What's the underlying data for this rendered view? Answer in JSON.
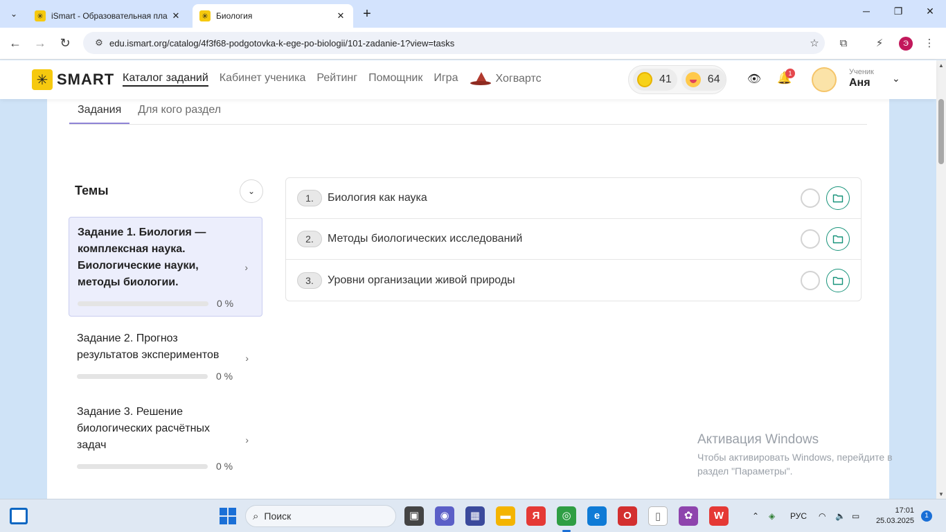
{
  "browser": {
    "tabs": [
      {
        "title": "iSmart - Образовательная пла",
        "active": false
      },
      {
        "title": "Биология",
        "active": true
      }
    ],
    "url": "edu.ismart.org/catalog/4f3f68-podgotovka-k-ege-po-biologii/101-zadanie-1?view=tasks",
    "profile_initial": "Э"
  },
  "header": {
    "logo_text": "SMART",
    "nav": [
      "Каталог заданий",
      "Кабинет ученика",
      "Рейтинг",
      "Помощник",
      "Игра",
      "Хогвартс"
    ],
    "coins": "41",
    "smiles": "64",
    "notifications": "1",
    "user_role": "Ученик",
    "user_name": "Аня"
  },
  "subtabs": [
    "Задания",
    "Для кого раздел"
  ],
  "themes": {
    "title": "Темы",
    "items": [
      {
        "title": "Задание 1. Биология — комплексная наука. Биологические науки, методы биологии.",
        "progress": "0 %",
        "progress_value": 0,
        "selected": true
      },
      {
        "title": "Задание 2. Прогноз результатов экспериментов",
        "progress": "0 %",
        "progress_value": 0,
        "selected": false
      },
      {
        "title": "Задание 3. Решение биологических расчётных задач",
        "progress": "0 %",
        "progress_value": 0,
        "selected": false
      }
    ]
  },
  "tasks": [
    {
      "num": "1.",
      "title": "Биология как наука"
    },
    {
      "num": "2.",
      "title": "Методы биологических исследований"
    },
    {
      "num": "3.",
      "title": "Уровни организации живой природы"
    }
  ],
  "watermark": {
    "title": "Активация Windows",
    "text": "Чтобы активировать Windows, перейдите в раздел \"Параметры\"."
  },
  "taskbar": {
    "search_placeholder": "Поиск",
    "language": "РУС",
    "time": "17:01",
    "date": "25.03.2025",
    "notification_count": "1"
  },
  "colors": {
    "accent_purple": "#8e83d6",
    "folder_green": "#17937a",
    "brand_yellow": "#f6c90e"
  }
}
